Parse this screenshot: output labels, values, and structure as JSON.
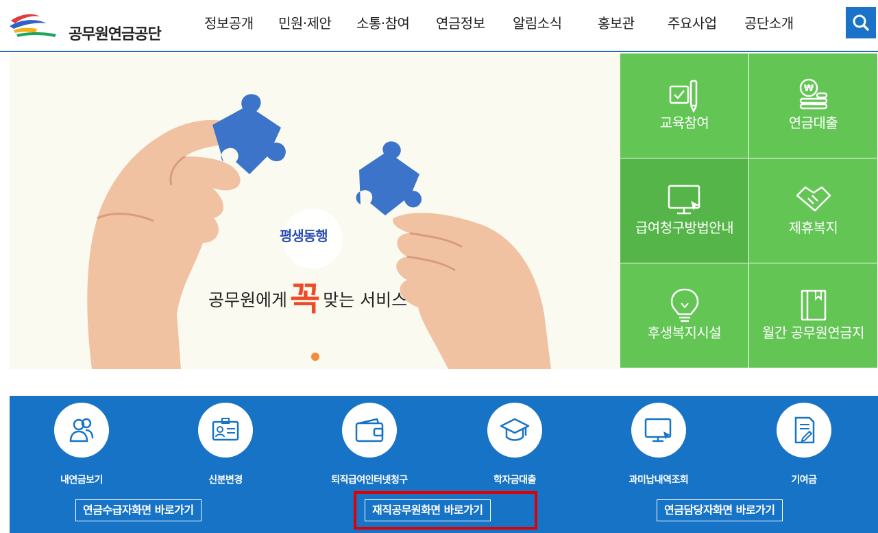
{
  "header": {
    "logo_text": "공무원연금공단",
    "nav": [
      "정보공개",
      "민원·제안",
      "소통·참여",
      "연금정보",
      "알림소식",
      "홍보관",
      "주요사업",
      "공단소개"
    ],
    "search_icon": "search-icon"
  },
  "banner": {
    "badge_text": "평생동행",
    "headline_before": "공무원에게",
    "headline_emphasis": "꼭",
    "headline_after": "맞는 서비스",
    "slide_count": 1,
    "active_slide": 1
  },
  "quick_menu": [
    {
      "label": "교육참여",
      "icon": "education-icon"
    },
    {
      "label": "연금대출",
      "icon": "loan-coins-icon"
    },
    {
      "label": "급여청구방법안내",
      "icon": "monitor-icon"
    },
    {
      "label": "제휴복지",
      "icon": "handshake-icon"
    },
    {
      "label": "후생복지시설",
      "icon": "lightbulb-icon"
    },
    {
      "label": "월간 공무원연금지",
      "icon": "book-icon"
    }
  ],
  "services": [
    {
      "label": "내연금보기",
      "icon": "people-icon"
    },
    {
      "label": "신분변경",
      "icon": "id-card-icon"
    },
    {
      "label": "퇴직급여인터넷청구",
      "icon": "wallet-icon"
    },
    {
      "label": "학자금대출",
      "icon": "graduation-cap-icon"
    },
    {
      "label": "과미납내역조회",
      "icon": "monitor-icon"
    },
    {
      "label": "기여금",
      "icon": "document-icon"
    }
  ],
  "shortcuts": [
    "연금수급자화면 바로가기",
    "재직공무원화면 바로가기",
    "연금담당자화면 바로가기"
  ],
  "colors": {
    "primary_blue": "#1673c6",
    "quick_green": "#62c554",
    "quick_green_dark": "#55b548",
    "accent_orange": "#ef4b27",
    "highlight_red": "#e00000"
  }
}
